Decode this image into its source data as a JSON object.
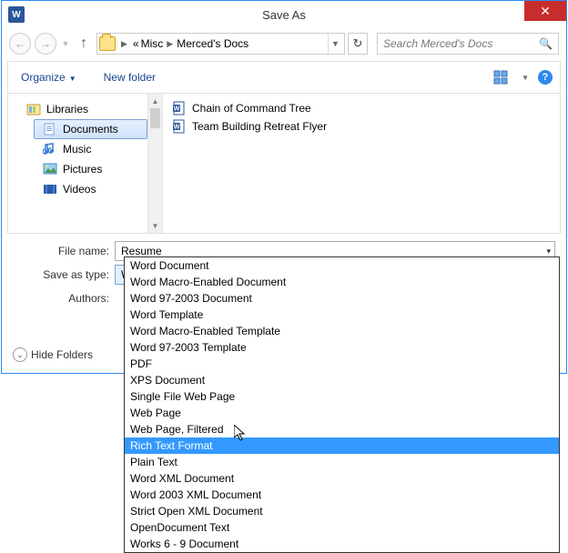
{
  "dialog_title": "Save As",
  "breadcrumbs": {
    "left_chevrons": "«",
    "part1": "Misc",
    "part2": "Merced's Docs"
  },
  "search": {
    "placeholder": "Search Merced's Docs"
  },
  "toolbar": {
    "organize": "Organize",
    "new_folder": "New folder"
  },
  "sidebar": {
    "root": "Libraries",
    "items": [
      "Documents",
      "Music",
      "Pictures",
      "Videos"
    ],
    "selected_index": 0
  },
  "files": [
    {
      "name": "Chain of Command Tree",
      "icon": "word"
    },
    {
      "name": "Team Building Retreat Flyer",
      "icon": "word"
    }
  ],
  "form": {
    "file_name_label": "File name:",
    "file_name_value": "Resume",
    "save_type_label": "Save as type:",
    "save_type_value": "Word Document",
    "authors_label": "Authors:"
  },
  "hide_folders": "Hide Folders",
  "type_options": [
    "Word Document",
    "Word Macro-Enabled Document",
    "Word 97-2003 Document",
    "Word Template",
    "Word Macro-Enabled Template",
    "Word 97-2003 Template",
    "PDF",
    "XPS Document",
    "Single File Web Page",
    "Web Page",
    "Web Page, Filtered",
    "Rich Text Format",
    "Plain Text",
    "Word XML Document",
    "Word 2003 XML Document",
    "Strict Open XML Document",
    "OpenDocument Text",
    "Works 6 - 9 Document"
  ],
  "type_highlighted_index": 11
}
